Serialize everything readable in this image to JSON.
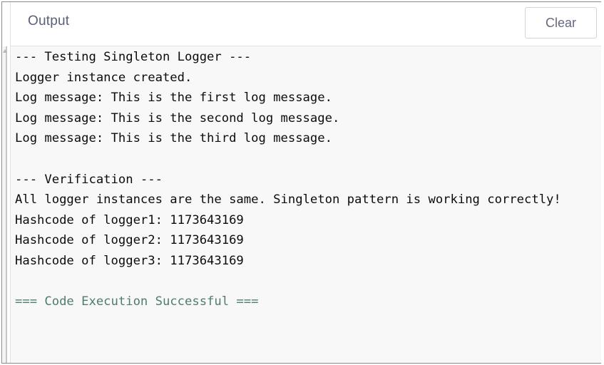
{
  "header": {
    "title": "Output",
    "clear_label": "Clear"
  },
  "output": {
    "lines": [
      {
        "text": "--- Testing Singleton Logger ---",
        "kind": "normal"
      },
      {
        "text": "Logger instance created.",
        "kind": "normal"
      },
      {
        "text": "Log message: This is the first log message.",
        "kind": "normal"
      },
      {
        "text": "Log message: This is the second log message.",
        "kind": "normal"
      },
      {
        "text": "Log message: This is the third log message.",
        "kind": "normal"
      },
      {
        "text": "",
        "kind": "normal"
      },
      {
        "text": "--- Verification ---",
        "kind": "normal"
      },
      {
        "text": "All logger instances are the same. Singleton pattern is working correctly!",
        "kind": "normal"
      },
      {
        "text": "Hashcode of logger1: 1173643169",
        "kind": "normal"
      },
      {
        "text": "Hashcode of logger2: 1173643169",
        "kind": "normal"
      },
      {
        "text": "Hashcode of logger3: 1173643169",
        "kind": "normal"
      },
      {
        "text": "",
        "kind": "normal"
      },
      {
        "text": "=== Code Execution Successful ===",
        "kind": "success"
      }
    ]
  },
  "colors": {
    "text": "#0c0c0c",
    "success": "#4e7d6b",
    "header_text": "#5a5f78",
    "output_background": "#f8f8f8"
  },
  "icons": {
    "scroll_up": "scroll-up-arrow-icon"
  }
}
